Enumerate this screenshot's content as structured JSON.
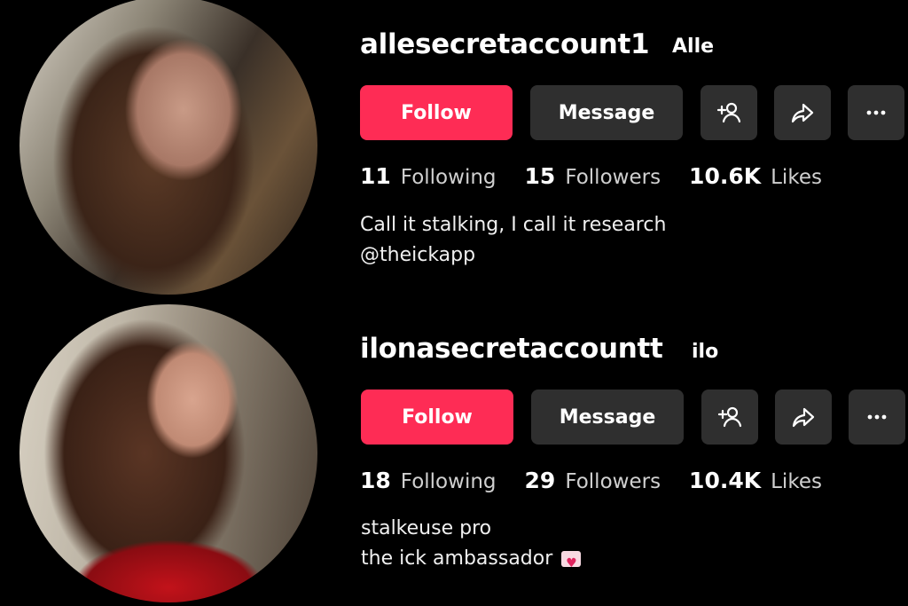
{
  "profiles": [
    {
      "username": "allesecretaccount1",
      "display_name": "Alle",
      "buttons": {
        "follow": "Follow",
        "message": "Message"
      },
      "icons": {
        "add_friend": "add-user-icon",
        "share": "share-icon",
        "more": "more-icon"
      },
      "stats": {
        "following_count": "11",
        "following_label": "Following",
        "followers_count": "15",
        "followers_label": "Followers",
        "likes_count": "10.6K",
        "likes_label": "Likes"
      },
      "bio": [
        "Call it stalking, I call it research",
        "@theickapp"
      ]
    },
    {
      "username": "ilonasecretaccountt",
      "display_name": "ilo",
      "buttons": {
        "follow": "Follow",
        "message": "Message"
      },
      "icons": {
        "add_friend": "add-user-icon",
        "share": "share-icon",
        "more": "more-icon"
      },
      "stats": {
        "following_count": "18",
        "following_label": "Following",
        "followers_count": "29",
        "followers_label": "Followers",
        "likes_count": "10.4K",
        "likes_label": "Likes"
      },
      "bio": [
        "stalkeuse pro",
        "the ick ambassador"
      ],
      "bio_emoji": "heart-letter-emoji"
    }
  ],
  "colors": {
    "follow_button": "#fe2c55",
    "secondary_button": "#2f2f2f",
    "background": "#000000"
  }
}
